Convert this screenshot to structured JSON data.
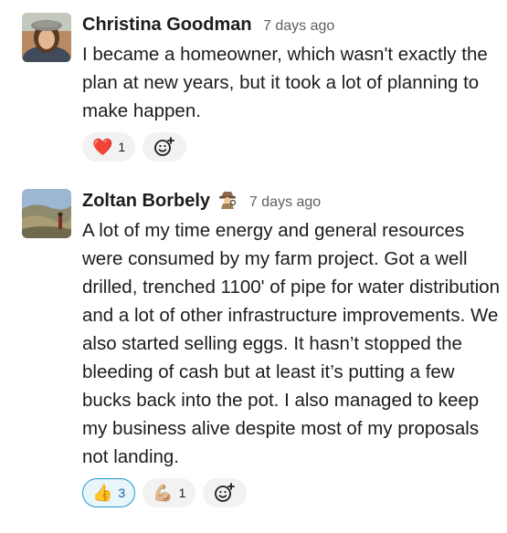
{
  "messages": [
    {
      "author": "Christina Goodman",
      "time": "7 days ago",
      "text": "I became a homeowner, which wasn't exactly the plan at new years, but it took a lot of planning to make happen.",
      "reactions": [
        {
          "emoji": "❤️",
          "count": "1",
          "icon": "heart-icon"
        }
      ]
    },
    {
      "author": "Zoltan Borbely",
      "status_icon": "detective-icon",
      "time": "7 days ago",
      "text": "A lot of my time energy and general resources were consumed by my farm project.  Got a well drilled, trenched 1100' of pipe for water distribution and a lot of other infrastructure improvements.  We also started selling eggs.  It hasn’t stopped the bleeding of cash but at least it’s putting a few bucks back into the pot.  I also managed to keep my business alive despite most of my proposals not landing.",
      "reactions": [
        {
          "emoji": "👍",
          "count": "3",
          "icon": "thumbs-up-icon",
          "active": true
        },
        {
          "emoji": "💪🏼",
          "count": "1",
          "icon": "flexed-biceps-icon"
        }
      ]
    }
  ],
  "colors": {
    "text": "#1d1c1d",
    "timestamp": "#616061",
    "reaction_bg": "#f2f2f2",
    "active_border": "#1d9bd1"
  }
}
